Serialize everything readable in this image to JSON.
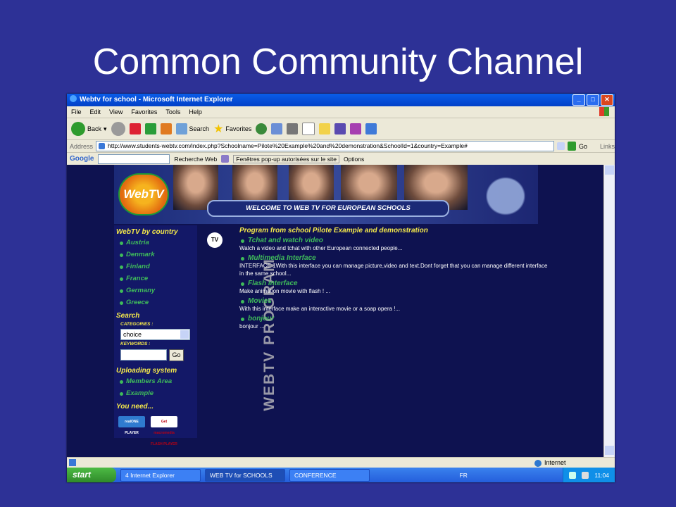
{
  "slide": {
    "title": "Common Community Channel"
  },
  "window": {
    "title": "Webtv for school - Microsoft Internet Explorer"
  },
  "menu": [
    "File",
    "Edit",
    "View",
    "Favorites",
    "Tools",
    "Help"
  ],
  "toolbar": {
    "back": "Back",
    "search": "Search",
    "favorites": "Favorites"
  },
  "address": {
    "label": "Address",
    "url": "http://www.students-webtv.com/index.php?Schoolname=Pilote%20Example%20and%20demonstration&SchoolId=1&country=Example#",
    "go": "Go",
    "links": "Links"
  },
  "google": {
    "label": "Google",
    "search_web": "Recherche Web",
    "popups": "Fenêtres pop-up autorisées sur le site",
    "options": "Options"
  },
  "banner": {
    "logo": "WebTV",
    "welcome": "WELCOME TO WEB TV FOR EUROPEAN SCHOOLS"
  },
  "sidebar": {
    "by_country": "WebTV by country",
    "countries": [
      "Austria",
      "Denmark",
      "Finland",
      "France",
      "Germany",
      "Greece"
    ],
    "search": "Search",
    "categories_label": "CATEGORIES :",
    "category_value": "choice",
    "keywords_label": "KEYWORDS :",
    "go": "Go",
    "uploading": "Uploading system",
    "upload_items": [
      "Members Area",
      "Example"
    ],
    "you_need": "You need...",
    "badge_real": "realONE PLAYER",
    "badge_flash": "Get macromedia FLASH PLAYER"
  },
  "tv_icon": "TV",
  "vertical_label": "WEBTV PROGRAM",
  "program": {
    "title": "Program from school Pilote Example and demonstration",
    "items": [
      {
        "title": "Tchat and watch video",
        "desc": "Watch a video and tchat with other European connected people..."
      },
      {
        "title": "Multimedia Interface",
        "desc": "INTERFACE 1With this interface you can manage picture,video and text.Dont forget that you can manage different interface in the same school..."
      },
      {
        "title": "Flash interface",
        "desc": "Make animation movie with flash ! ..."
      },
      {
        "title": "Movies",
        "desc": "With this interface make an interactive movie or a soap opera !..."
      },
      {
        "title": "bonjour",
        "desc": "bonjour ..."
      }
    ]
  },
  "status": {
    "zone": "Internet"
  },
  "taskbar": {
    "start": "start",
    "tasks": [
      "4 Internet Explorer",
      "WEB TV for SCHOOLS",
      "CONFERENCE"
    ],
    "lang": "FR",
    "clock": "11:04"
  }
}
